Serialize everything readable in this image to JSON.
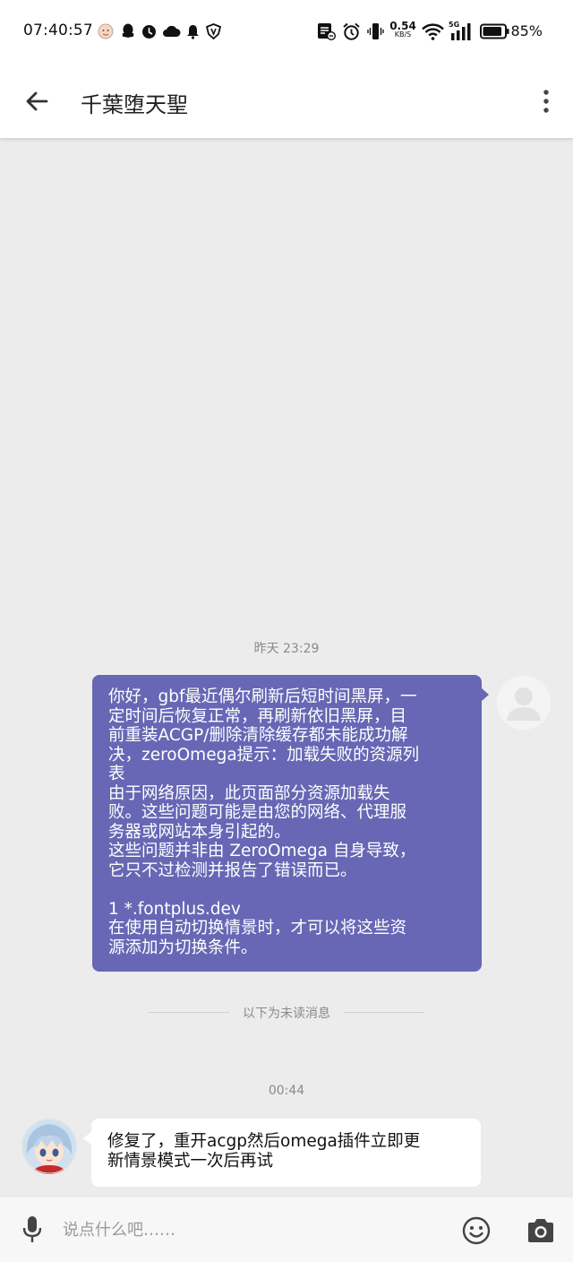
{
  "status_bar": {
    "time": "07:40:57",
    "net_speed_value": "0.54",
    "net_speed_unit": "KB/S",
    "signal_badge": "5G",
    "battery_percent": "85%",
    "icons": [
      "avatar-notification-icon",
      "qq-icon",
      "clock-notification-icon",
      "cloud-icon",
      "bell-icon",
      "vpn-shield-icon",
      "nfc-icon",
      "alarm-icon",
      "vibrate-icon",
      "wifi-icon",
      "cellular-signal-icon",
      "battery-icon"
    ]
  },
  "app_bar": {
    "title": "千葉堕天聖",
    "icons": [
      "back-arrow-icon",
      "more-vert-icon"
    ]
  },
  "chat": {
    "timestamp_1": "昨天 23:29",
    "sent_message": {
      "lines": [
        "你好，gbf最近偶尔刷新后短时间黑屏，一",
        "定时间后恢复正常，再刷新依旧黑屏，目",
        "前重装ACGP/删除清除缓存都未能成功解",
        "决，zeroOmega提示：加载失败的资源列",
        "表",
        "由于网络原因，此页面部分资源加载失",
        "败。这些问题可能是由您的网络、代理服",
        "务器或网站本身引起的。",
        "这些问题并非由 ZeroOmega 自身导致，",
        "它只不过检测并报告了错误而已。",
        "",
        "1 *.fontplus.dev",
        "在使用自动切换情景时，才可以将这些资",
        "源添加为切换条件。"
      ]
    },
    "unread_divider": "以下为未读消息",
    "timestamp_2": "00:44",
    "received_message": {
      "lines": [
        "修复了，重开acgp然后omega插件立即更",
        "新情景模式一次后再试"
      ]
    }
  },
  "input_bar": {
    "placeholder": "说点什么吧……",
    "value": "",
    "icons": [
      "microphone-icon",
      "emoji-icon",
      "camera-icon"
    ]
  },
  "colors": {
    "sent_bubble": "#6767b5",
    "received_bubble": "#ffffff",
    "chat_background": "#ececec",
    "timestamp_text": "#8a8a8a"
  }
}
